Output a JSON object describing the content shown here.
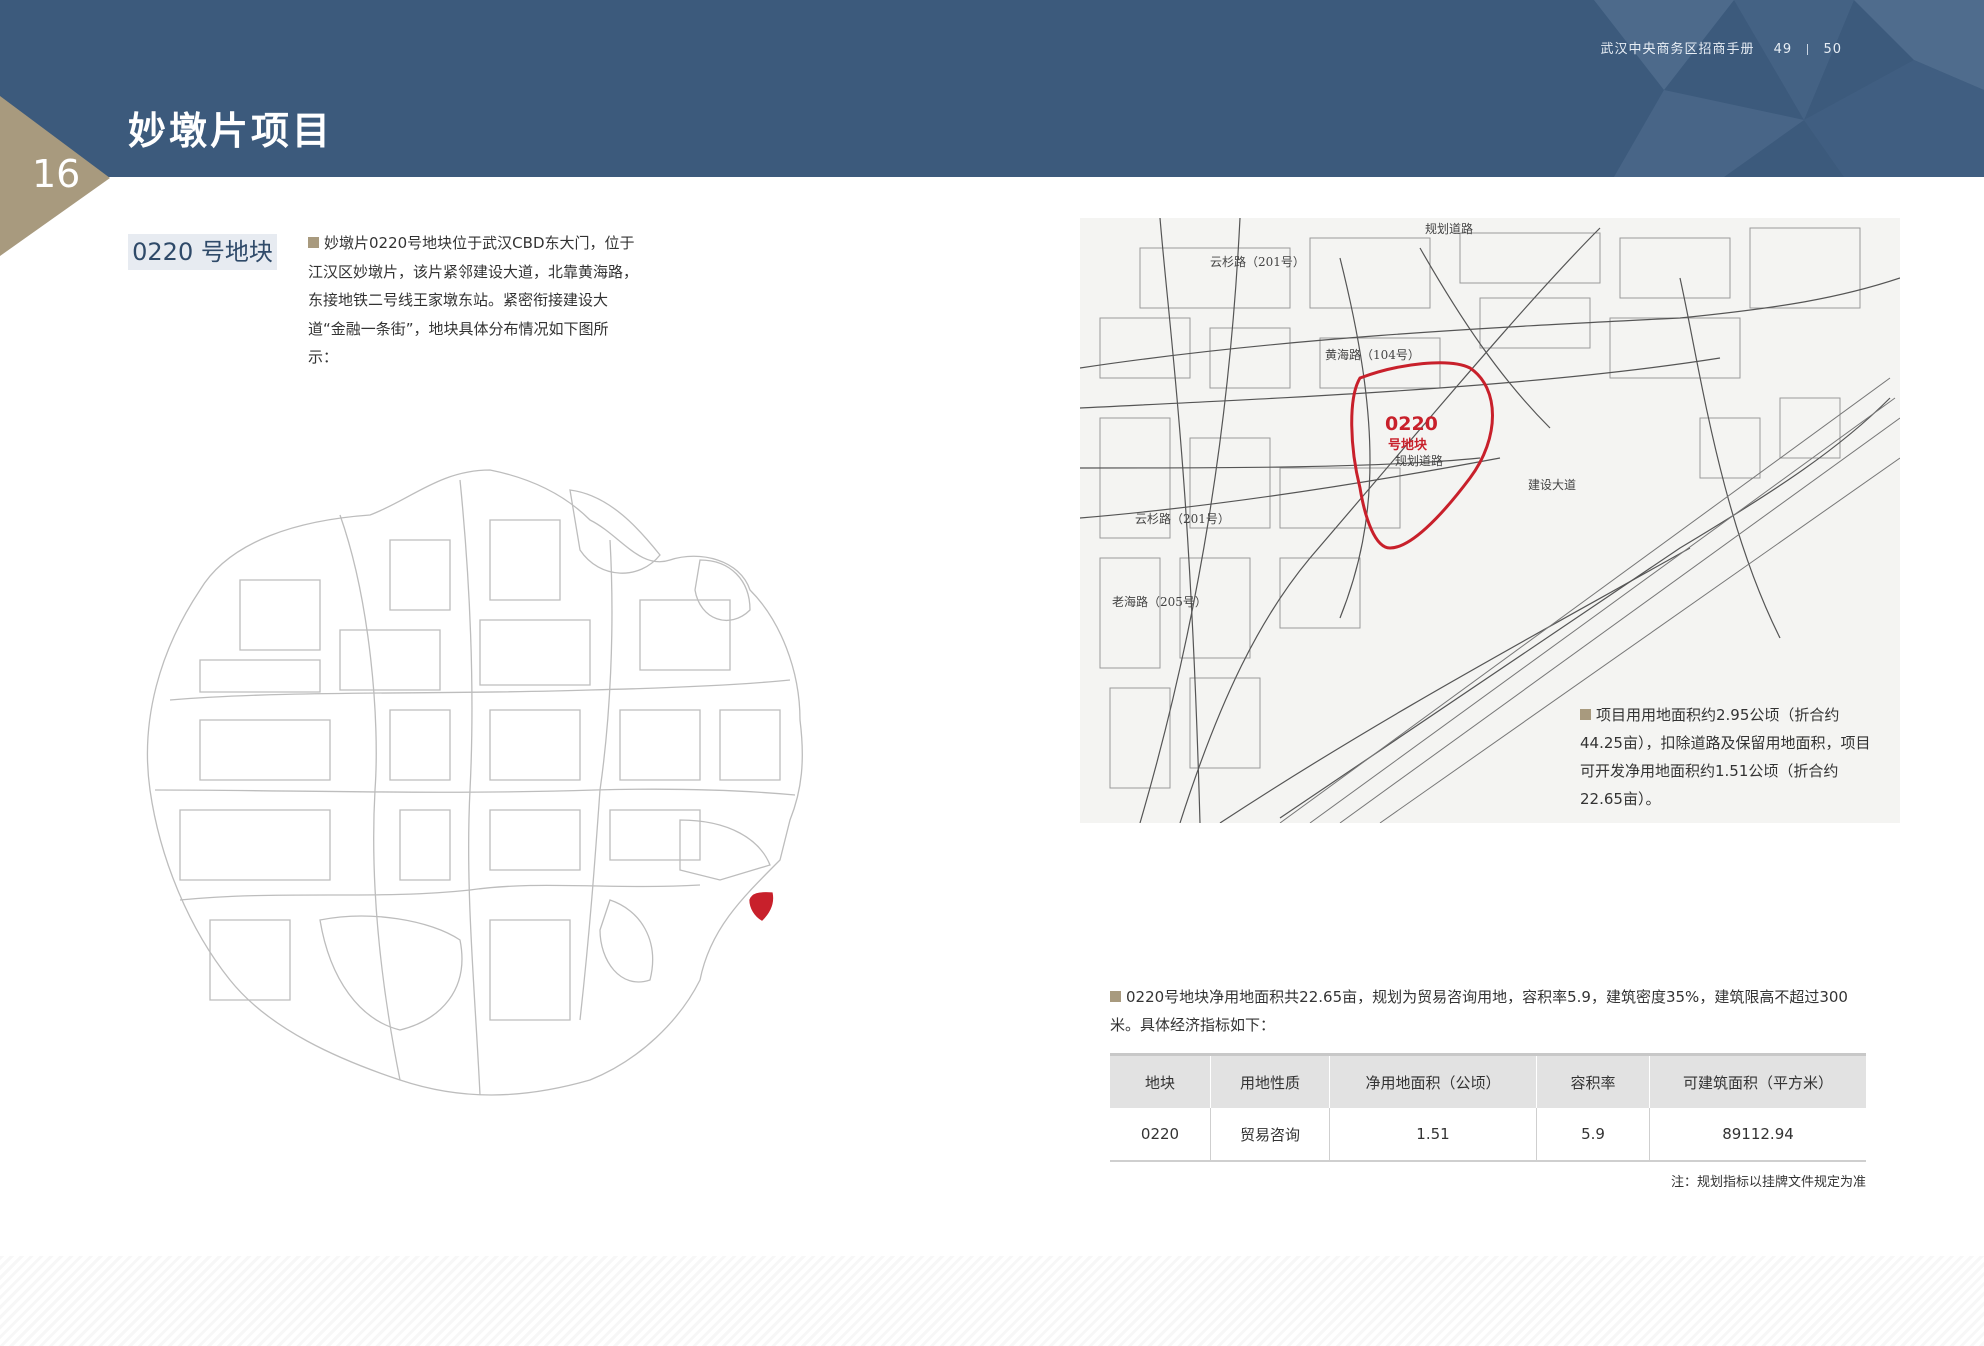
{
  "header": {
    "doc_title": "武汉中央商务区招商手册",
    "page_left": "49",
    "page_right": "50",
    "section_title": "妙墩片项目",
    "section_number": "16",
    "bg_color": "#3c5a7c",
    "accent_color": "#a89a7e"
  },
  "left": {
    "subheading": "0220 号地块",
    "intro": "妙墩片0220号地块位于武汉CBD东大门，位于江汉区妙墩片，该片紧邻建设大道，北靠黄海路，东接地铁二号线王家墩东站。紧密衔接建设大道“金融一条街”，地块具体分布情况如下图所示："
  },
  "site_map": {
    "plot_label_line1": "0220",
    "plot_label_line2": "号地块",
    "roads": {
      "planned_north": "规划道路",
      "yunshan_north": "云杉路（201号）",
      "huanghai": "黄海路（104号）",
      "planned_mid": "规划道路",
      "jianshe": "建设大道",
      "yunshan_south": "云杉路（201号）",
      "road_205": "老海路（205号）"
    },
    "note": "项目用用地面积约2.95公顷（折合约44.25亩），扣除道路及保留用地面积，项目可开发净用地面积约1.51公顷（折合约22.65亩）。",
    "highlight_color": "#c8202b"
  },
  "economics": {
    "intro": "0220号地块净用地面积共22.65亩，规划为贸易咨询用地，容积率5.9，建筑密度35%，建筑限高不超过300米。具体经济指标如下：",
    "headers": [
      "地块",
      "用地性质",
      "净用地面积（公顷）",
      "容积率",
      "可建筑面积（平方米）"
    ],
    "row": [
      "0220",
      "贸易咨询",
      "1.51",
      "5.9",
      "89112.94"
    ],
    "footnote": "注：规划指标以挂牌文件规定为准"
  }
}
